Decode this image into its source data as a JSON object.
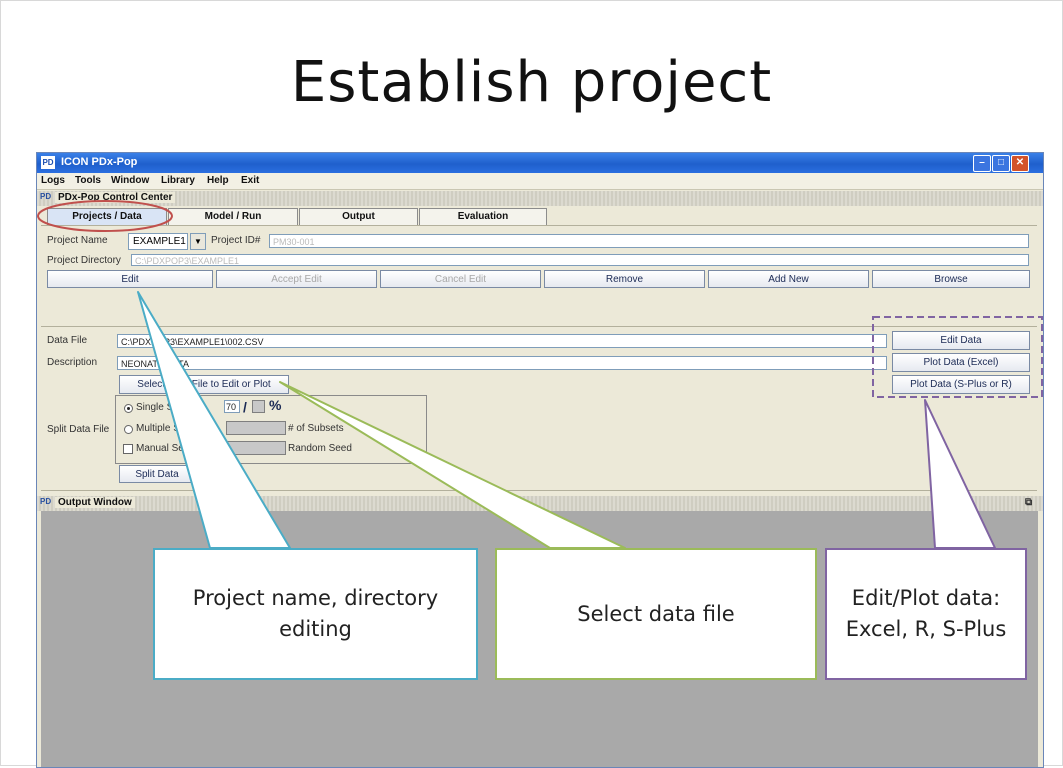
{
  "slide": {
    "title": "Establish project"
  },
  "window": {
    "icon_text": "PD",
    "title": "ICON PDx-Pop",
    "controls": {
      "minimize": "–",
      "maximize": "□",
      "close": "✕"
    }
  },
  "menu": [
    "Logs",
    "Tools",
    "Window",
    "Library",
    "Help",
    "Exit"
  ],
  "control_center": {
    "icon_text": "PD",
    "title": "PDx-Pop Control Center"
  },
  "tabs": [
    "Projects / Data",
    "Model / Run",
    "Output",
    "Evaluation"
  ],
  "project": {
    "name_label": "Project Name",
    "name_value": "EXAMPLE1",
    "id_label": "Project ID#",
    "id_value": "PM30-001",
    "directory_label": "Project Directory",
    "directory_value": "C:\\PDXPOP3\\EXAMPLE1"
  },
  "project_buttons": {
    "edit": "Edit",
    "accept_edit": "Accept Edit",
    "cancel_edit": "Cancel Edit",
    "remove": "Remove",
    "add_new": "Add New",
    "browse": "Browse"
  },
  "data": {
    "file_label": "Data File",
    "file_value": "C:\\PDXPOP3\\EXAMPLE1\\002.CSV",
    "description_label": "Description",
    "description_value": "NEONATE DATA",
    "select_button": "Select Data File to Edit or Plot",
    "edit_data": "Edit Data",
    "plot_excel": "Plot Data (Excel)",
    "plot_splus_r": "Plot Data (S-Plus or R)"
  },
  "split": {
    "label": "Split Data File",
    "single": "Single Split",
    "ratio_value": "70",
    "ratio_sep": "/",
    "percent": "%",
    "multiple": "Multiple Subsets",
    "subsets_label": "# of Subsets",
    "manual_seed": "Manual Seed",
    "random_seed": "Random Seed",
    "split_button": "Split Data"
  },
  "output_window": {
    "icon_text": "PD",
    "title": "Output Window",
    "expand_icon": "⧉"
  },
  "callouts": {
    "project_line1": "Project name, directory",
    "project_line2": "editing",
    "select": "Select data file",
    "plot_line1": "Edit/Plot data:",
    "plot_line2": "Excel, R, S-Plus"
  },
  "colors": {
    "blue_callout": "#4bacc6",
    "green_callout": "#9bbb59",
    "purple_callout": "#8064a2",
    "highlight_ellipse": "#c0504d"
  }
}
